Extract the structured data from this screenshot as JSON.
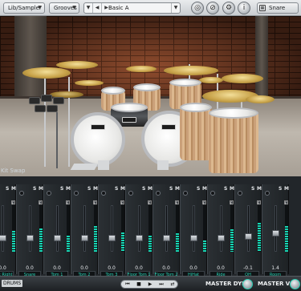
{
  "toolbar": {
    "lib_sampler": "Lib/Sampler",
    "grooves": "Grooves",
    "preset": "Basic A",
    "instrument": "Snare"
  },
  "stage": {
    "kit_swap": "Kit Swap"
  },
  "mixer": {
    "channels": [
      {
        "name": "Kick Right",
        "value": "0.0",
        "level": 0.45,
        "fader": 0.3
      },
      {
        "name": "Snare",
        "value": "0.0",
        "level": 0.5,
        "fader": 0.3
      },
      {
        "name": "Tom 1",
        "value": "0.0",
        "level": 0.35,
        "fader": 0.3
      },
      {
        "name": "Tom 2",
        "value": "0.0",
        "level": 0.55,
        "fader": 0.3
      },
      {
        "name": "Tom 3",
        "value": "0.0",
        "level": 0.42,
        "fader": 0.3
      },
      {
        "name": "Floor Tom 1",
        "value": "0.0",
        "level": 0.35,
        "fader": 0.3
      },
      {
        "name": "Floor Tom 2",
        "value": "0.0",
        "level": 0.4,
        "fader": 0.3
      },
      {
        "name": "HiHat",
        "value": "0.0",
        "level": 0.25,
        "fader": 0.3
      },
      {
        "name": "Ride",
        "value": "0.0",
        "level": 0.48,
        "fader": 0.3
      },
      {
        "name": "OH",
        "value": "-0.1",
        "level": 0.62,
        "fader": 0.32
      },
      {
        "name": "Room",
        "value": "1.4",
        "level": 0.55,
        "fader": 0.4
      }
    ],
    "solo_label": "S",
    "mute_label": "M",
    "filter_label": "F"
  },
  "bottom": {
    "drums_badge": "DRUMS",
    "master_dyn": "MASTER DYN",
    "master_vol": "MASTER VOL"
  },
  "colors": {
    "accent": "#27d3b5",
    "meter": "#17d7b5"
  }
}
